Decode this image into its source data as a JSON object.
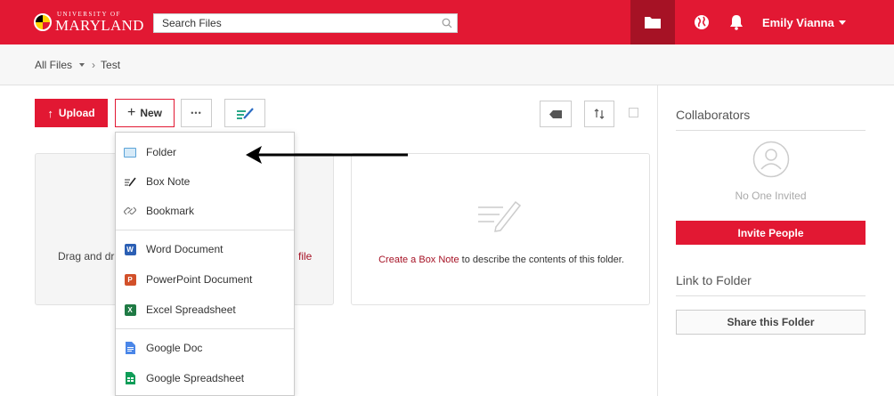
{
  "header": {
    "logo_small": "UNIVERSITY OF",
    "logo_big": "MARYLAND",
    "search_placeholder": "Search Files",
    "user_name": "Emily Vianna",
    "brand_color": "#e21833"
  },
  "breadcrumb": {
    "root": "All Files",
    "current": "Test",
    "separator": "›"
  },
  "toolbar": {
    "upload_label": "Upload",
    "upload_icon": "↑",
    "new_label": "New",
    "new_icon": "+",
    "more_label": "•••"
  },
  "new_menu": {
    "items": [
      {
        "label": "Folder",
        "icon": "folder-icon"
      },
      {
        "label": "Box Note",
        "icon": "box-note-icon"
      },
      {
        "label": "Bookmark",
        "icon": "bookmark-icon"
      },
      {
        "label": "Word Document",
        "icon": "word-icon"
      },
      {
        "label": "PowerPoint Document",
        "icon": "powerpoint-icon"
      },
      {
        "label": "Excel Spreadsheet",
        "icon": "excel-icon"
      },
      {
        "label": "Google Doc",
        "icon": "google-doc-icon"
      },
      {
        "label": "Google Spreadsheet",
        "icon": "google-sheet-icon"
      }
    ]
  },
  "drop_zone": {
    "text_start": "Drag and dr",
    "text_end": "file"
  },
  "box_note": {
    "link_text": "Create a Box Note",
    "rest_text": " to describe the contents of this folder."
  },
  "sidebar": {
    "collaborators_title": "Collaborators",
    "no_one_invited": "No One Invited",
    "invite_label": "Invite People",
    "link_title": "Link to Folder",
    "share_label": "Share this Folder"
  }
}
